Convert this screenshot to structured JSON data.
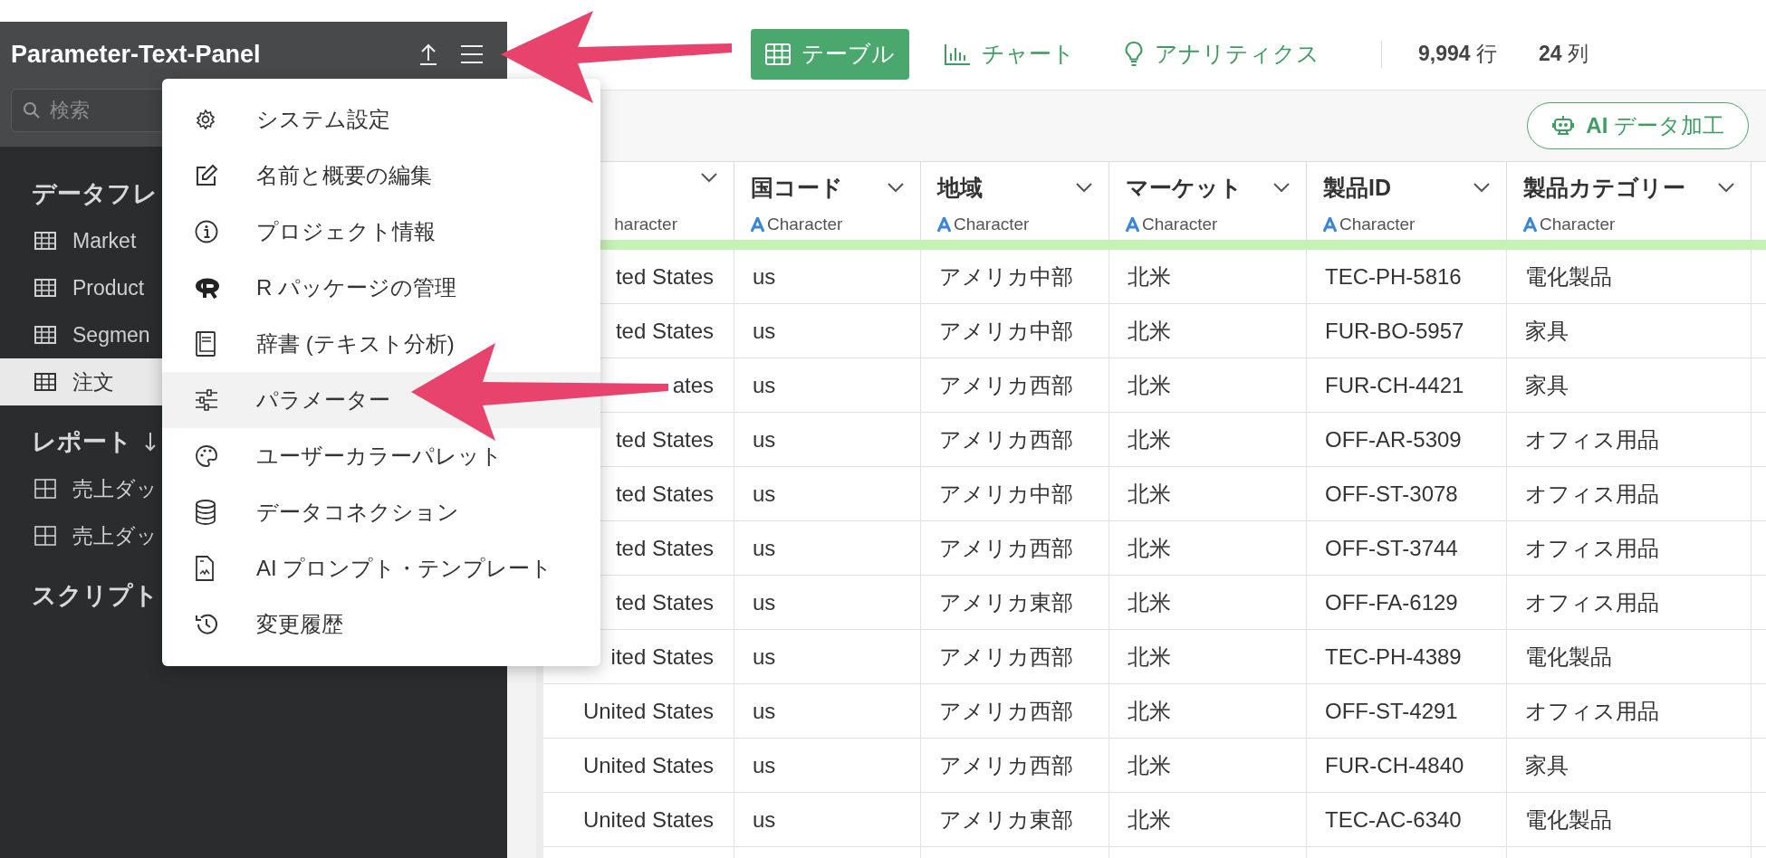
{
  "sidebar": {
    "title": "Parameter-Text-Panel",
    "search": {
      "placeholder": "検索"
    },
    "sections": [
      {
        "kind": "dataframe",
        "heading": "データフレ",
        "items": [
          {
            "label": "Market",
            "selected": false
          },
          {
            "label": "Product",
            "selected": false
          },
          {
            "label": "Segmen",
            "selected": false
          },
          {
            "label": "注文",
            "selected": true
          }
        ]
      },
      {
        "kind": "report",
        "heading": "レポート",
        "items": [
          {
            "label": "売上ダッ",
            "selected": false
          },
          {
            "label": "売上ダッ",
            "selected": false
          }
        ]
      },
      {
        "kind": "script",
        "heading": "スクリプト"
      }
    ]
  },
  "menu": {
    "items": [
      {
        "label": "システム設定",
        "highlighted": false
      },
      {
        "label": "名前と概要の編集",
        "highlighted": false
      },
      {
        "label": "プロジェクト情報",
        "highlighted": false
      },
      {
        "label": "R パッケージの管理",
        "highlighted": false
      },
      {
        "label": "辞書 (テキスト分析)",
        "highlighted": false
      },
      {
        "label": "パラメーター",
        "highlighted": true
      },
      {
        "label": "ユーザーカラーパレット",
        "highlighted": false
      },
      {
        "label": "データコネクション",
        "highlighted": false
      },
      {
        "label": "AI プロンプト・テンプレート",
        "highlighted": false
      },
      {
        "label": "変更履歴",
        "highlighted": false
      }
    ]
  },
  "topbar": {
    "tabs": [
      {
        "label": "テーブル",
        "selected": true
      },
      {
        "label": "チャート",
        "selected": false
      },
      {
        "label": "アナリティクス",
        "selected": false
      }
    ],
    "row_count": {
      "value": "9,994",
      "unit": "行"
    },
    "column_count": {
      "value": "24",
      "unit": "列"
    }
  },
  "toolbar": {
    "ai_button": "**AI** データ加工"
  },
  "table": {
    "columns": [
      {
        "type": "haracter"
      },
      {
        "name": "国コード",
        "type": "Character"
      },
      {
        "name": "地域",
        "type": "Character"
      },
      {
        "name": "マーケット",
        "type": "Character"
      },
      {
        "name": "製品ID",
        "type": "Character"
      },
      {
        "name": "製品カテゴリー",
        "type": "Character"
      }
    ],
    "rows": [
      [
        "ted States",
        "us",
        "アメリカ中部",
        "北米",
        "TEC-PH-5816",
        "電化製品"
      ],
      [
        "ted States",
        "us",
        "アメリカ中部",
        "北米",
        "FUR-BO-5957",
        "家具"
      ],
      [
        "ates",
        "us",
        "アメリカ西部",
        "北米",
        "FUR-CH-4421",
        "家具"
      ],
      [
        "ted States",
        "us",
        "アメリカ西部",
        "北米",
        "OFF-AR-5309",
        "オフィス用品"
      ],
      [
        "ted States",
        "us",
        "アメリカ中部",
        "北米",
        "OFF-ST-3078",
        "オフィス用品"
      ],
      [
        "ted States",
        "us",
        "アメリカ西部",
        "北米",
        "OFF-ST-3744",
        "オフィス用品"
      ],
      [
        "ted States",
        "us",
        "アメリカ東部",
        "北米",
        "OFF-FA-6129",
        "オフィス用品"
      ],
      [
        "ited States",
        "us",
        "アメリカ西部",
        "北米",
        "TEC-PH-4389",
        "電化製品"
      ],
      [
        "United States",
        "us",
        "アメリカ西部",
        "北米",
        "OFF-ST-4291",
        "オフィス用品"
      ],
      [
        "United States",
        "us",
        "アメリカ西部",
        "北米",
        "FUR-CH-4840",
        "家具"
      ],
      [
        "United States",
        "us",
        "アメリカ東部",
        "北米",
        "TEC-AC-6340",
        "電化製品"
      ]
    ]
  }
}
